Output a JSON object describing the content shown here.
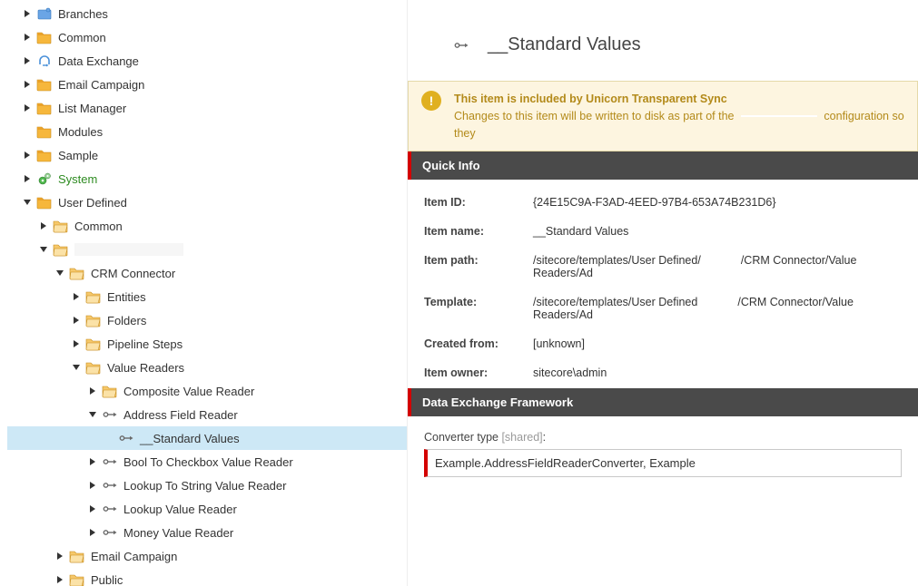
{
  "tree": [
    {
      "id": "branches",
      "label": "Branches",
      "depth": 0,
      "icon": "branches",
      "expander": "closed"
    },
    {
      "id": "common0",
      "label": "Common",
      "depth": 0,
      "icon": "folder",
      "expander": "closed"
    },
    {
      "id": "datax",
      "label": "Data Exchange",
      "depth": 0,
      "icon": "exchange",
      "expander": "closed"
    },
    {
      "id": "emailc0",
      "label": "Email Campaign",
      "depth": 0,
      "icon": "folder",
      "expander": "closed"
    },
    {
      "id": "listmgr",
      "label": "List Manager",
      "depth": 0,
      "icon": "folder",
      "expander": "closed"
    },
    {
      "id": "modules",
      "label": "Modules",
      "depth": 0,
      "icon": "folder",
      "expander": "none"
    },
    {
      "id": "sample",
      "label": "Sample",
      "depth": 0,
      "icon": "folder",
      "expander": "closed"
    },
    {
      "id": "system",
      "label": "System",
      "depth": 0,
      "icon": "system",
      "expander": "closed",
      "cls": "system"
    },
    {
      "id": "userdef",
      "label": "User Defined",
      "depth": 0,
      "icon": "folder",
      "expander": "open"
    },
    {
      "id": "common1",
      "label": "Common",
      "depth": 1,
      "icon": "folder-o",
      "expander": "closed"
    },
    {
      "id": "blank1",
      "label": "",
      "depth": 1,
      "icon": "folder-o",
      "expander": "open",
      "blanklabel": true
    },
    {
      "id": "crmconn",
      "label": "CRM Connector",
      "depth": 2,
      "icon": "folder-o",
      "expander": "open"
    },
    {
      "id": "entities",
      "label": "Entities",
      "depth": 3,
      "icon": "folder-o",
      "expander": "closed"
    },
    {
      "id": "folders",
      "label": "Folders",
      "depth": 3,
      "icon": "folder-o",
      "expander": "closed"
    },
    {
      "id": "pipesteps",
      "label": "Pipeline Steps",
      "depth": 3,
      "icon": "folder-o",
      "expander": "closed"
    },
    {
      "id": "valread",
      "label": "Value Readers",
      "depth": 3,
      "icon": "folder-o",
      "expander": "open"
    },
    {
      "id": "compvr",
      "label": "Composite Value Reader",
      "depth": 4,
      "icon": "folder-o",
      "expander": "closed"
    },
    {
      "id": "afr",
      "label": "Address Field Reader",
      "depth": 4,
      "icon": "pipe",
      "expander": "open"
    },
    {
      "id": "stdvals",
      "label": "__Standard Values",
      "depth": 5,
      "icon": "pipe",
      "expander": "none",
      "selected": true
    },
    {
      "id": "b2c",
      "label": "Bool To Checkbox Value Reader",
      "depth": 4,
      "icon": "pipe",
      "expander": "closed"
    },
    {
      "id": "l2s",
      "label": "Lookup To String Value Reader",
      "depth": 4,
      "icon": "pipe",
      "expander": "closed"
    },
    {
      "id": "lvr",
      "label": "Lookup Value Reader",
      "depth": 4,
      "icon": "pipe",
      "expander": "closed"
    },
    {
      "id": "mvr",
      "label": "Money Value Reader",
      "depth": 4,
      "icon": "pipe",
      "expander": "closed"
    },
    {
      "id": "emailc2",
      "label": "Email Campaign",
      "depth": 2,
      "icon": "folder-o",
      "expander": "closed"
    },
    {
      "id": "public",
      "label": "Public",
      "depth": 2,
      "icon": "folder-o",
      "expander": "closed"
    }
  ],
  "page": {
    "title": "__Standard Values"
  },
  "banner": {
    "line1": "This item is included by Unicorn Transparent Sync",
    "line2a": "Changes to this item will be written to disk as part of the ",
    "line2b": " configuration so they"
  },
  "sections": {
    "quickinfo": "Quick Info",
    "def": "Data Exchange Framework"
  },
  "info": {
    "k_itemid": "Item ID:",
    "v_itemid": "{24E15C9A-F3AD-4EED-97B4-653A74B231D6}",
    "k_itemname": "Item name:",
    "v_itemname": "__Standard Values",
    "k_itempath": "Item path:",
    "v_itempath_a": "/sitecore/templates/User Defined/",
    "v_itempath_b": "/CRM Connector/Value Readers/Ad",
    "k_template": "Template:",
    "v_template_a": "/sitecore/templates/User Defined",
    "v_template_b": "/CRM Connector/Value Readers/Ad",
    "k_created": "Created from:",
    "v_created": "[unknown]",
    "k_owner": "Item owner:",
    "v_owner": "sitecore\\admin"
  },
  "field": {
    "label": "Converter type",
    "shared": " [shared]",
    "colon": ":",
    "value": "Example.AddressFieldReaderConverter, Example"
  }
}
